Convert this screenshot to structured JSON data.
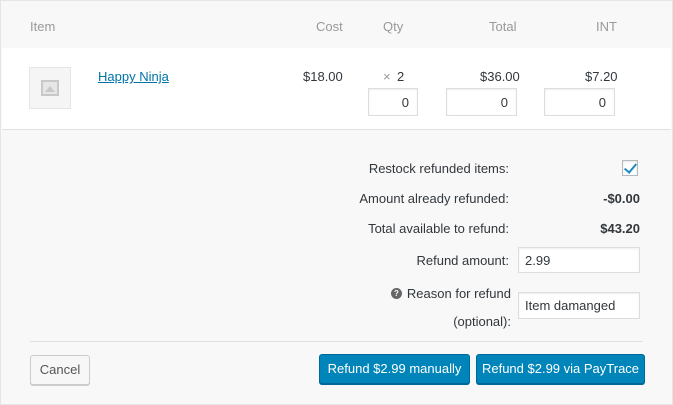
{
  "table": {
    "headers": {
      "item": "Item",
      "cost": "Cost",
      "qty": "Qty",
      "total": "Total",
      "int": "INT"
    },
    "row": {
      "thumbnail_icon": "image-placeholder-icon",
      "name": "Happy Ninja",
      "cost": "$18.00",
      "qty_prefix": "×",
      "qty": "2",
      "total": "$36.00",
      "int": "$7.20",
      "refund_qty": "0",
      "refund_total": "0",
      "refund_int": "0"
    }
  },
  "refund": {
    "restock_label": "Restock refunded items:",
    "restock_checked": true,
    "already_refunded_label": "Amount already refunded:",
    "already_refunded_value": "-$0.00",
    "available_label": "Total available to refund:",
    "available_value": "$43.20",
    "amount_label": "Refund amount:",
    "amount_value": "2.99",
    "reason_icon": "help-icon",
    "reason_help_glyph": "?",
    "reason_label_line1": "Reason for refund",
    "reason_label_line2": "(optional):",
    "reason_value": "Item damanged"
  },
  "actions": {
    "cancel": "Cancel",
    "refund_manual": "Refund $2.99 manually",
    "refund_gateway": "Refund $2.99 via PayTrace"
  },
  "colors": {
    "primary": "#0085ba",
    "link": "#0073aa",
    "check": "#1e8cbe"
  }
}
